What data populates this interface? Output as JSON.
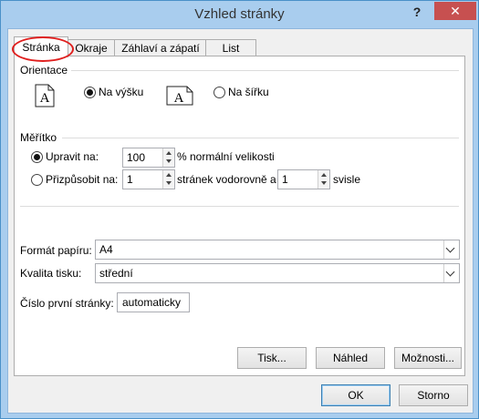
{
  "window": {
    "title": "Vzhled stránky",
    "help_label": "?",
    "close_label": "✕"
  },
  "tabs": [
    {
      "label": "Stránka",
      "active": true
    },
    {
      "label": "Okraje"
    },
    {
      "label": "Záhlaví a zápatí"
    },
    {
      "label": "List"
    }
  ],
  "orientation": {
    "group_label": "Orientace",
    "portrait_label": "Na výšku",
    "landscape_label": "Na šířku",
    "selected": "portrait",
    "icon_letter": "A"
  },
  "scaling": {
    "group_label": "Měřítko",
    "adjust_label": "Upravit na:",
    "adjust_value": "100",
    "adjust_suffix": "% normální velikosti",
    "fit_label": "Přizpůsobit na:",
    "fit_wide_value": "1",
    "fit_wide_suffix": "stránek vodorovně a",
    "fit_tall_value": "1",
    "fit_tall_suffix": "svisle",
    "selected": "adjust"
  },
  "paper": {
    "size_label": "Formát papíru:",
    "size_value": "A4",
    "quality_label": "Kvalita tisku:",
    "quality_value": "střední",
    "first_page_label": "Číslo první stránky:",
    "first_page_value": "automaticky"
  },
  "panel_buttons": {
    "print": "Tisk...",
    "preview": "Náhled",
    "options": "Možnosti..."
  },
  "dialog_buttons": {
    "ok": "OK",
    "cancel": "Storno"
  },
  "colors": {
    "frame": "#a9cdee",
    "close": "#c75050",
    "highlight": "#e0201f"
  }
}
